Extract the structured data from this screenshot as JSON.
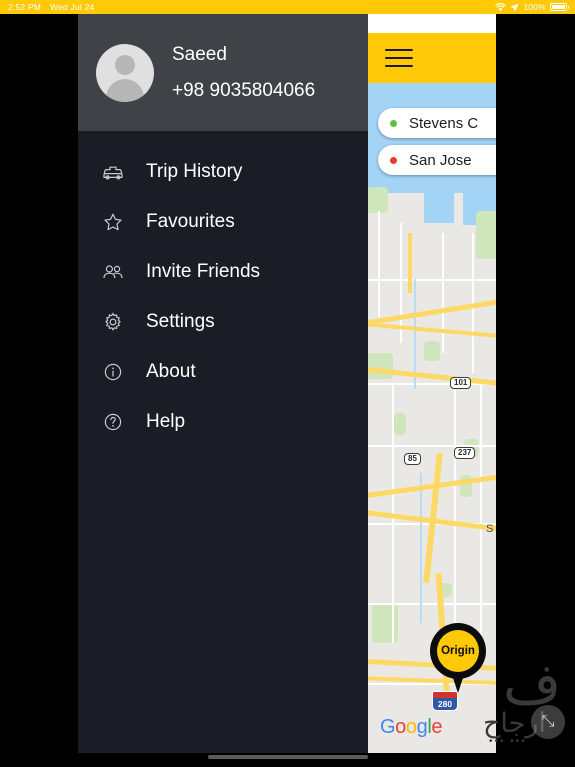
{
  "status_bar": {
    "time": "2:52 PM",
    "date": "Wed Jul 24",
    "battery_percent": "100%",
    "wifi_icon": "wifi-icon",
    "location_icon": "location-arrow-icon",
    "battery_icon": "battery-full-icon",
    "background_color": "#FFC907",
    "text_color": "#FFFFFF"
  },
  "drawer": {
    "profile": {
      "name": "Saeed",
      "phone": "+98 9035804066",
      "avatar_icon": "avatar-placeholder-icon",
      "background_color": "#3F4246"
    },
    "background_color": "#1B1D26",
    "items": [
      {
        "label": "Trip History",
        "icon": "taxi-icon"
      },
      {
        "label": "Favourites",
        "icon": "star-icon"
      },
      {
        "label": "Invite Friends",
        "icon": "people-icon"
      },
      {
        "label": "Settings",
        "icon": "gear-icon"
      },
      {
        "label": "About",
        "icon": "info-circle-icon"
      },
      {
        "label": "Help",
        "icon": "question-circle-icon"
      }
    ]
  },
  "map_panel": {
    "toolbar": {
      "menu_icon": "hamburger-menu-icon",
      "background_color": "#FFC907"
    },
    "chips": [
      {
        "label": "Stevens C",
        "dot_color": "#5FC13C",
        "dot_name": "origin-dot"
      },
      {
        "label": "San Jose",
        "dot_color": "#EB3B2E",
        "dot_name": "destination-dot"
      }
    ],
    "pin": {
      "label": "Origin",
      "body_color": "#0B0B0B",
      "fill_color": "#FFC907"
    },
    "highway_shields": [
      {
        "number": "101",
        "type": "us"
      },
      {
        "number": "237",
        "type": "state"
      },
      {
        "number": "85",
        "type": "state"
      },
      {
        "number": "280",
        "type": "interstate"
      }
    ],
    "street_label": "S",
    "attribution": {
      "g1": "G",
      "o1": "o",
      "o2": "o",
      "g2": "g",
      "l": "l",
      "e": "e"
    },
    "colors": {
      "water": "#A3D3F5",
      "land": "#E9E8E4",
      "park": "#CFE6BD",
      "major_road": "#FCD965",
      "minor_road": "#FFFFFF"
    }
  },
  "watermark": {
    "mark": "ف",
    "text": "ارجاح",
    "dots": "••• •••"
  },
  "cursor": {
    "glyph": "⤡",
    "name": "resize-cursor"
  }
}
